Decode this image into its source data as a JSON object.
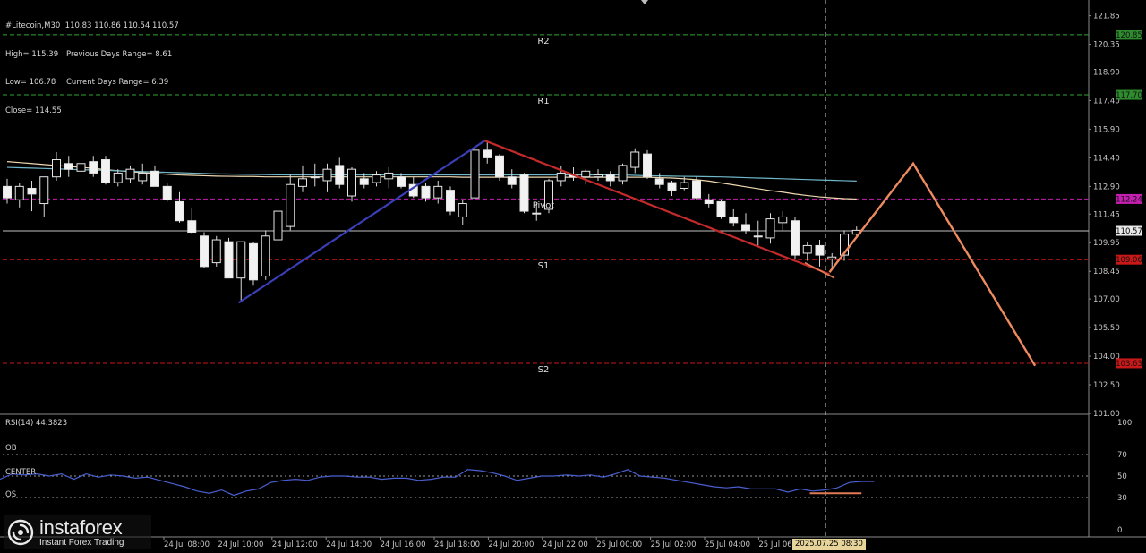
{
  "header": {
    "symbol_line": "#Litecoin,M30  110.83 110.86 110.54 110.57",
    "high": "High= 115.39",
    "prev_range": "Previous Days Range= 8.61",
    "low": "Low= 106.78",
    "curr_range": "Current Days Range= 6.39",
    "close": "Close= 114.55"
  },
  "pivot_labels": {
    "r2": "R2",
    "r1": "R1",
    "pivot": "Pivot",
    "s1": "S1",
    "s2": "S2"
  },
  "price_axis": [
    "121.85",
    "120.35",
    "118.90",
    "117.40",
    "115.90",
    "114.40",
    "112.90",
    "111.45",
    "109.95",
    "108.45",
    "107.00",
    "105.50",
    "104.00",
    "102.50",
    "101.00"
  ],
  "price_badges": [
    {
      "label": "120.85",
      "price": 120.85,
      "color": "#2e8b2e"
    },
    {
      "label": "117.70",
      "price": 117.7,
      "color": "#2e8b2e"
    },
    {
      "label": "112.24",
      "price": 112.24,
      "color": "#c41fb0"
    },
    {
      "label": "110.57",
      "price": 110.57,
      "color": "#e8e8e8"
    },
    {
      "label": "109.06",
      "price": 109.06,
      "color": "#c81818"
    },
    {
      "label": "103.63",
      "price": 103.63,
      "color": "#c81818"
    }
  ],
  "rsi": {
    "title": "RSI(14) 44.3823",
    "ob_label": "OB",
    "center_label": "CENTER",
    "os_label": "OS",
    "axis": [
      "100",
      "70",
      "50",
      "30",
      "0"
    ]
  },
  "time_axis": [
    "24 Jul 08:00",
    "24 Jul 10:00",
    "24 Jul 12:00",
    "24 Jul 14:00",
    "24 Jul 16:00",
    "24 Jul 18:00",
    "24 Jul 20:00",
    "24 Jul 22:00",
    "25 Jul 00:00",
    "25 Jul 02:00",
    "25 Jul 04:00",
    "25 Jul 06:00"
  ],
  "time_badge": "2025.07.25 08:30",
  "logo": {
    "brand": "instaforex",
    "tagline": "Instant Forex Trading"
  },
  "chart_data": {
    "type": "candlestick",
    "symbol": "#Litecoin",
    "timeframe": "M30",
    "ylim": [
      101.0,
      122.3
    ],
    "pivot_levels": {
      "R2": 120.85,
      "R1": 117.7,
      "Pivot": 112.24,
      "S1": 109.06,
      "S2": 103.63
    },
    "current_price": 110.57,
    "candles": [
      {
        "o": 112.9,
        "h": 113.3,
        "l": 112.0,
        "c": 112.3
      },
      {
        "o": 112.2,
        "h": 113.1,
        "l": 111.8,
        "c": 112.9
      },
      {
        "o": 112.8,
        "h": 113.2,
        "l": 111.6,
        "c": 112.5
      },
      {
        "o": 112.0,
        "h": 113.4,
        "l": 111.3,
        "c": 113.4
      },
      {
        "o": 113.4,
        "h": 114.7,
        "l": 113.2,
        "c": 114.3
      },
      {
        "o": 114.1,
        "h": 114.5,
        "l": 113.4,
        "c": 113.8
      },
      {
        "o": 113.7,
        "h": 114.4,
        "l": 113.5,
        "c": 114.1
      },
      {
        "o": 114.2,
        "h": 114.5,
        "l": 113.4,
        "c": 113.6
      },
      {
        "o": 114.3,
        "h": 114.5,
        "l": 113.0,
        "c": 113.1
      },
      {
        "o": 113.1,
        "h": 113.8,
        "l": 112.9,
        "c": 113.6
      },
      {
        "o": 113.3,
        "h": 114.0,
        "l": 113.1,
        "c": 113.8
      },
      {
        "o": 113.2,
        "h": 114.1,
        "l": 113.0,
        "c": 113.6
      },
      {
        "o": 113.7,
        "h": 114.0,
        "l": 112.9,
        "c": 112.9
      },
      {
        "o": 112.9,
        "h": 113.1,
        "l": 112.1,
        "c": 112.2
      },
      {
        "o": 112.1,
        "h": 112.6,
        "l": 111.0,
        "c": 111.1
      },
      {
        "o": 111.1,
        "h": 111.8,
        "l": 110.4,
        "c": 110.5
      },
      {
        "o": 110.3,
        "h": 110.5,
        "l": 108.6,
        "c": 108.7
      },
      {
        "o": 108.9,
        "h": 110.3,
        "l": 108.7,
        "c": 110.1
      },
      {
        "o": 110.0,
        "h": 110.2,
        "l": 108.1,
        "c": 108.1
      },
      {
        "o": 108.1,
        "h": 110.0,
        "l": 106.9,
        "c": 110.0
      },
      {
        "o": 109.9,
        "h": 110.0,
        "l": 107.7,
        "c": 108.0
      },
      {
        "o": 108.2,
        "h": 110.6,
        "l": 108.0,
        "c": 110.3
      },
      {
        "o": 110.1,
        "h": 111.9,
        "l": 110.1,
        "c": 111.6
      },
      {
        "o": 110.8,
        "h": 113.5,
        "l": 110.6,
        "c": 113.0
      },
      {
        "o": 112.9,
        "h": 114.0,
        "l": 112.6,
        "c": 113.3
      },
      {
        "o": 113.4,
        "h": 114.1,
        "l": 112.9,
        "c": 113.4
      },
      {
        "o": 113.2,
        "h": 114.1,
        "l": 112.6,
        "c": 113.8
      },
      {
        "o": 114.0,
        "h": 114.4,
        "l": 112.8,
        "c": 113.0
      },
      {
        "o": 112.4,
        "h": 113.9,
        "l": 112.1,
        "c": 113.8
      },
      {
        "o": 113.3,
        "h": 113.6,
        "l": 112.8,
        "c": 113.0
      },
      {
        "o": 113.1,
        "h": 113.7,
        "l": 112.9,
        "c": 113.5
      },
      {
        "o": 113.3,
        "h": 113.9,
        "l": 112.8,
        "c": 113.6
      },
      {
        "o": 113.4,
        "h": 113.6,
        "l": 112.8,
        "c": 112.9
      },
      {
        "o": 113.0,
        "h": 113.4,
        "l": 112.3,
        "c": 112.4
      },
      {
        "o": 112.9,
        "h": 113.1,
        "l": 112.1,
        "c": 112.3
      },
      {
        "o": 112.3,
        "h": 113.2,
        "l": 112.0,
        "c": 112.9
      },
      {
        "o": 112.7,
        "h": 112.9,
        "l": 111.4,
        "c": 111.6
      },
      {
        "o": 111.3,
        "h": 112.2,
        "l": 110.9,
        "c": 112.0
      },
      {
        "o": 112.3,
        "h": 115.3,
        "l": 112.1,
        "c": 114.8
      },
      {
        "o": 114.8,
        "h": 115.2,
        "l": 114.1,
        "c": 114.4
      },
      {
        "o": 114.5,
        "h": 114.6,
        "l": 113.2,
        "c": 113.4
      },
      {
        "o": 113.4,
        "h": 113.8,
        "l": 112.8,
        "c": 113.0
      },
      {
        "o": 113.5,
        "h": 113.6,
        "l": 111.5,
        "c": 111.6
      },
      {
        "o": 111.5,
        "h": 112.0,
        "l": 111.1,
        "c": 111.5
      },
      {
        "o": 111.7,
        "h": 113.3,
        "l": 111.5,
        "c": 113.2
      },
      {
        "o": 113.2,
        "h": 114.0,
        "l": 112.9,
        "c": 113.6
      },
      {
        "o": 113.5,
        "h": 113.9,
        "l": 113.2,
        "c": 113.4
      },
      {
        "o": 113.4,
        "h": 113.8,
        "l": 113.0,
        "c": 113.7
      },
      {
        "o": 113.4,
        "h": 113.8,
        "l": 113.2,
        "c": 113.5
      },
      {
        "o": 113.5,
        "h": 113.7,
        "l": 112.9,
        "c": 113.2
      },
      {
        "o": 113.2,
        "h": 114.1,
        "l": 113.0,
        "c": 114.0
      },
      {
        "o": 113.9,
        "h": 114.9,
        "l": 113.6,
        "c": 114.7
      },
      {
        "o": 114.6,
        "h": 114.8,
        "l": 113.3,
        "c": 113.4
      },
      {
        "o": 113.3,
        "h": 113.6,
        "l": 112.8,
        "c": 113.0
      },
      {
        "o": 113.1,
        "h": 113.2,
        "l": 112.4,
        "c": 112.7
      },
      {
        "o": 112.8,
        "h": 113.4,
        "l": 112.7,
        "c": 113.1
      },
      {
        "o": 113.2,
        "h": 113.4,
        "l": 112.2,
        "c": 112.3
      },
      {
        "o": 112.2,
        "h": 112.5,
        "l": 111.8,
        "c": 112.0
      },
      {
        "o": 112.1,
        "h": 112.2,
        "l": 111.2,
        "c": 111.3
      },
      {
        "o": 111.3,
        "h": 111.7,
        "l": 110.8,
        "c": 111.0
      },
      {
        "o": 110.9,
        "h": 111.5,
        "l": 110.4,
        "c": 110.6
      },
      {
        "o": 110.3,
        "h": 111.1,
        "l": 109.8,
        "c": 110.3
      },
      {
        "o": 110.2,
        "h": 111.5,
        "l": 109.9,
        "c": 111.2
      },
      {
        "o": 111.0,
        "h": 111.6,
        "l": 110.6,
        "c": 111.3
      },
      {
        "o": 111.1,
        "h": 111.3,
        "l": 109.1,
        "c": 109.3
      },
      {
        "o": 109.4,
        "h": 110.0,
        "l": 109.0,
        "c": 109.8
      },
      {
        "o": 109.8,
        "h": 110.1,
        "l": 108.7,
        "c": 109.3
      },
      {
        "o": 109.1,
        "h": 109.4,
        "l": 108.5,
        "c": 109.2
      },
      {
        "o": 109.3,
        "h": 110.6,
        "l": 109.0,
        "c": 110.4
      },
      {
        "o": 110.4,
        "h": 110.8,
        "l": 110.3,
        "c": 110.6
      }
    ],
    "moving_averages": [
      {
        "color": "#f0d8b0",
        "values": [
          114.2,
          114.15,
          114.1,
          114.05,
          114.0,
          113.95,
          113.9,
          113.85,
          113.78,
          113.72,
          113.68,
          113.62,
          113.58,
          113.54,
          113.5,
          113.48,
          113.46,
          113.44,
          113.43,
          113.42,
          113.42,
          113.4,
          113.4,
          113.4,
          113.4,
          113.4,
          113.4,
          113.4,
          113.4,
          113.4,
          113.4,
          113.4,
          113.4,
          113.4,
          113.4,
          113.4,
          113.4,
          113.38,
          113.38,
          113.38,
          113.38,
          113.38,
          113.38,
          113.38,
          113.38,
          113.38,
          113.38,
          113.38,
          113.38,
          113.38,
          113.38,
          113.38,
          113.38,
          113.36,
          113.34,
          113.3,
          113.25,
          113.18,
          113.08,
          112.98,
          112.88,
          112.78,
          112.68,
          112.6,
          112.5,
          112.42,
          112.35,
          112.3,
          112.26,
          112.24
        ]
      },
      {
        "color": "#6fb6c8",
        "values": [
          113.9,
          113.88,
          113.86,
          113.84,
          113.82,
          113.8,
          113.78,
          113.76,
          113.74,
          113.72,
          113.7,
          113.68,
          113.66,
          113.64,
          113.62,
          113.6,
          113.58,
          113.56,
          113.55,
          113.54,
          113.53,
          113.52,
          113.51,
          113.5,
          113.5,
          113.5,
          113.5,
          113.5,
          113.5,
          113.5,
          113.5,
          113.5,
          113.5,
          113.5,
          113.5,
          113.5,
          113.5,
          113.5,
          113.5,
          113.5,
          113.5,
          113.5,
          113.5,
          113.5,
          113.5,
          113.5,
          113.5,
          113.5,
          113.5,
          113.5,
          113.5,
          113.48,
          113.46,
          113.45,
          113.44,
          113.43,
          113.42,
          113.41,
          113.4,
          113.38,
          113.36,
          113.34,
          113.32,
          113.3,
          113.28,
          113.26,
          113.24,
          113.22,
          113.2,
          113.18
        ]
      }
    ],
    "annotations": {
      "blue_line": [
        {
          "i": 18.8,
          "p": 106.8
        },
        {
          "i": 38.8,
          "p": 115.3
        }
      ],
      "red_line": [
        {
          "i": 38.8,
          "p": 115.3
        },
        {
          "i": 66.8,
          "p": 108.3
        }
      ],
      "orange_short_line": [
        {
          "i": 64.8,
          "p": 108.9
        },
        {
          "i": 67.2,
          "p": 108.1
        }
      ],
      "forecast_path": [
        {
          "i": 66.8,
          "p": 108.4
        },
        {
          "i": 73.6,
          "p": 114.1
        },
        {
          "i": 83.5,
          "p": 103.5
        }
      ]
    },
    "rsi_values": [
      47,
      52,
      51,
      52,
      50,
      52,
      47,
      52,
      49,
      51,
      50,
      48,
      49,
      46,
      43,
      40,
      36,
      34,
      37,
      32,
      36,
      38,
      44,
      46,
      47,
      46,
      49,
      50,
      50,
      49,
      49,
      47,
      48,
      48,
      46,
      47,
      49,
      49,
      56,
      55,
      53,
      50,
      46,
      48,
      50,
      50,
      51,
      50,
      51,
      49,
      52,
      56,
      50,
      49,
      48,
      46,
      44,
      42,
      40,
      39,
      40,
      38,
      38,
      38,
      35,
      38,
      36,
      37,
      39,
      44,
      45,
      45
    ],
    "rsi_levels": {
      "OB": 70,
      "CENTER": 50,
      "OS": 30
    },
    "rsi_ylim": [
      0,
      100
    ]
  }
}
